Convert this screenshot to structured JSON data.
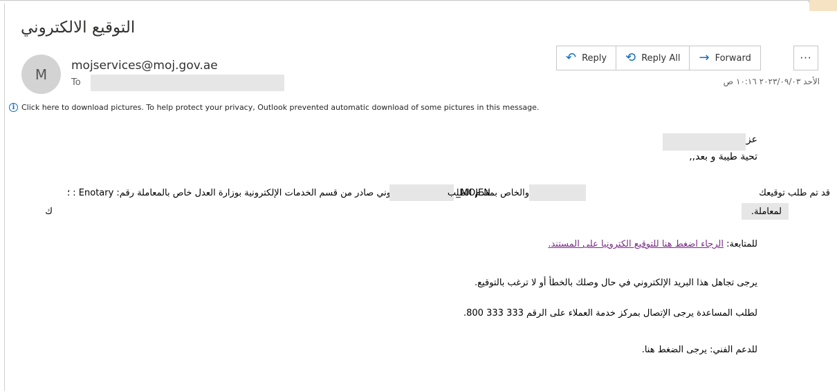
{
  "email": {
    "subject": "التوقيع الالكتروني",
    "avatar_initial": "M",
    "sender": "mojservices@moj.gov.ae",
    "to_label": "To",
    "timestamp": "الأحد ٢٠٢٣/٠٩/٠٣ ١٠:١٦ ص",
    "notice": "Click here to download pictures. To help protect your privacy, Outlook prevented automatic download of some pictures in this message."
  },
  "actions": {
    "reply": "Reply",
    "reply_all": "Reply All",
    "forward": "Forward",
    "more": "···"
  },
  "body": {
    "greeting": "عزيزي المتعامل",
    "salutation": "تحية طيبة و بعد,,",
    "para1_part1": "هذا البريد الإلكتروني صادر من قسم الخدمات الإلكترونية بوزارة العدل خاص بالمعاملة رقم: Enotary : ؛",
    "para1_part2": "MOJEN_",
    "para1_part3": "والخاص بمقدم الطلب",
    "para1_part4": "قد تم طلب توقيعك",
    "para1_line2_a": "ك",
    "para1_line2_b": "لمعاملة.",
    "followup_label": "للمتابعة:",
    "followup_link": "الرجاء اضغط هنا للتوقيع الكترونيا على المستند.",
    "ignore": "يرجى تجاهل هذا البريد الإلكتروني في حال وصلك بالخطأ أو لا ترغب بالتوقيع.",
    "help": "لطلب المساعدة يرجى الإتصال بمركز خدمة العملاء على الرقم 333 333 800.",
    "support": "للدعم الفني: يرجى الضغط هنا."
  }
}
